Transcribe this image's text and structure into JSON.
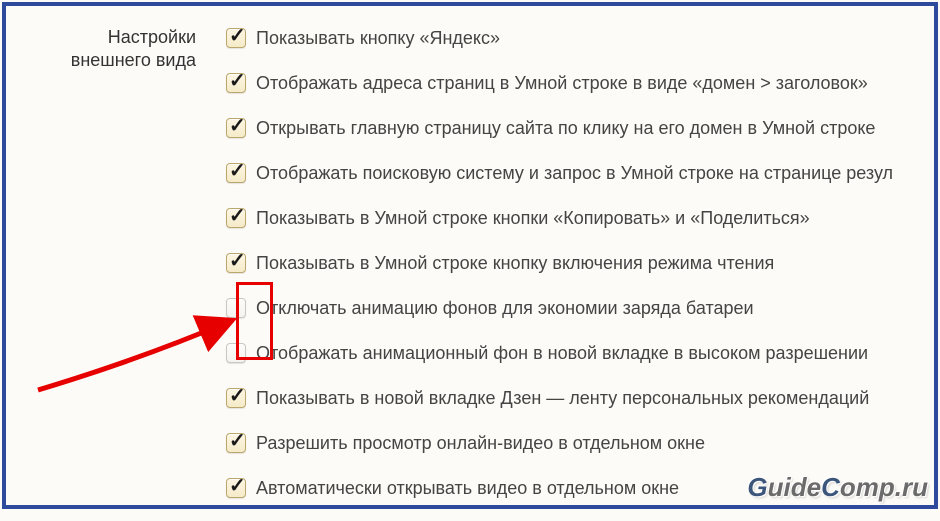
{
  "section": {
    "title": "Настройки внешнего вида"
  },
  "options": [
    {
      "checked": true,
      "highlighted": false,
      "label": "Показывать кнопку «Яндекс»"
    },
    {
      "checked": true,
      "highlighted": false,
      "label": "Отображать адреса страниц в Умной строке в виде «домен > заголовок»"
    },
    {
      "checked": true,
      "highlighted": false,
      "label": "Открывать главную страницу сайта по клику на его домен в Умной строке"
    },
    {
      "checked": true,
      "highlighted": false,
      "label": "Отображать поисковую систему и запрос в Умной строке на странице резул"
    },
    {
      "checked": true,
      "highlighted": false,
      "label": "Показывать в Умной строке кнопки «Копировать» и «Поделиться»"
    },
    {
      "checked": true,
      "highlighted": false,
      "label": "Показывать в Умной строке кнопку включения режима чтения"
    },
    {
      "checked": false,
      "highlighted": true,
      "label": "Отключать анимацию фонов для экономии заряда батареи"
    },
    {
      "checked": false,
      "highlighted": true,
      "label": "Отображать анимационный фон в новой вкладке в высоком разрешении"
    },
    {
      "checked": true,
      "highlighted": false,
      "label": "Показывать в новой вкладке Дзен — ленту персональных рекомендаций"
    },
    {
      "checked": true,
      "highlighted": false,
      "label": "Разрешить просмотр онлайн-видео в отдельном окне"
    },
    {
      "checked": true,
      "highlighted": false,
      "label": "Автоматически открывать видео в отдельном окне"
    }
  ],
  "annotation": {
    "highlight_color": "#e60000",
    "arrow_color": "#e60000"
  },
  "watermark": {
    "text": "GuideComp.ru"
  }
}
